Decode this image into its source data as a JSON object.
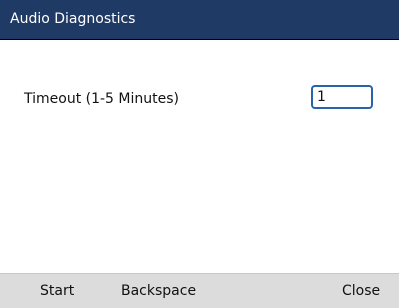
{
  "window": {
    "title": "Audio Diagnostics"
  },
  "form": {
    "timeout_label": "Timeout (1-5 Minutes)",
    "timeout_value": "1"
  },
  "softkeys": {
    "start": "Start",
    "backspace": "Backspace",
    "close": "Close"
  },
  "colors": {
    "titlebar_bg": "#1f3a64",
    "input_border": "#2a63a8",
    "softkey_bar_bg": "#dcdcdc"
  }
}
